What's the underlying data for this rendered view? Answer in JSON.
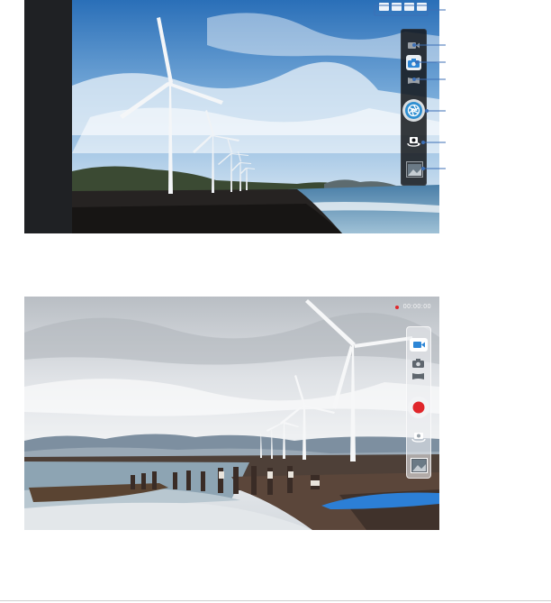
{
  "camera_screen": {
    "status_icons": [
      "camera-mode-indicator-icon",
      "flash-auto-icon",
      "resolution-icon",
      "auto-scene-icon"
    ],
    "status_labels": [
      "",
      "",
      "",
      ""
    ],
    "buttons": {
      "video_mode": "video-mode-icon",
      "camera_mode": "camera-mode-icon",
      "panorama_mode": "panorama-mode-icon",
      "shutter": "shutter-icon",
      "switch_camera": "switch-camera-icon",
      "gallery": "gallery-thumbnail-icon"
    },
    "colors": {
      "panel_bg": "#14161a",
      "shutter_ring": "#2f8fd1"
    }
  },
  "video_screen": {
    "recording_time": "00:00:00",
    "buttons": {
      "video_mode": "video-mode-icon",
      "camera_mode": "camera-mode-icon",
      "panorama_mode": "panorama-mode-icon",
      "record": "record-icon",
      "switch_camera": "switch-camera-icon",
      "gallery": "gallery-thumbnail-icon"
    },
    "colors": {
      "record": "#e0262b",
      "active_mode": "#2d86d6"
    }
  }
}
